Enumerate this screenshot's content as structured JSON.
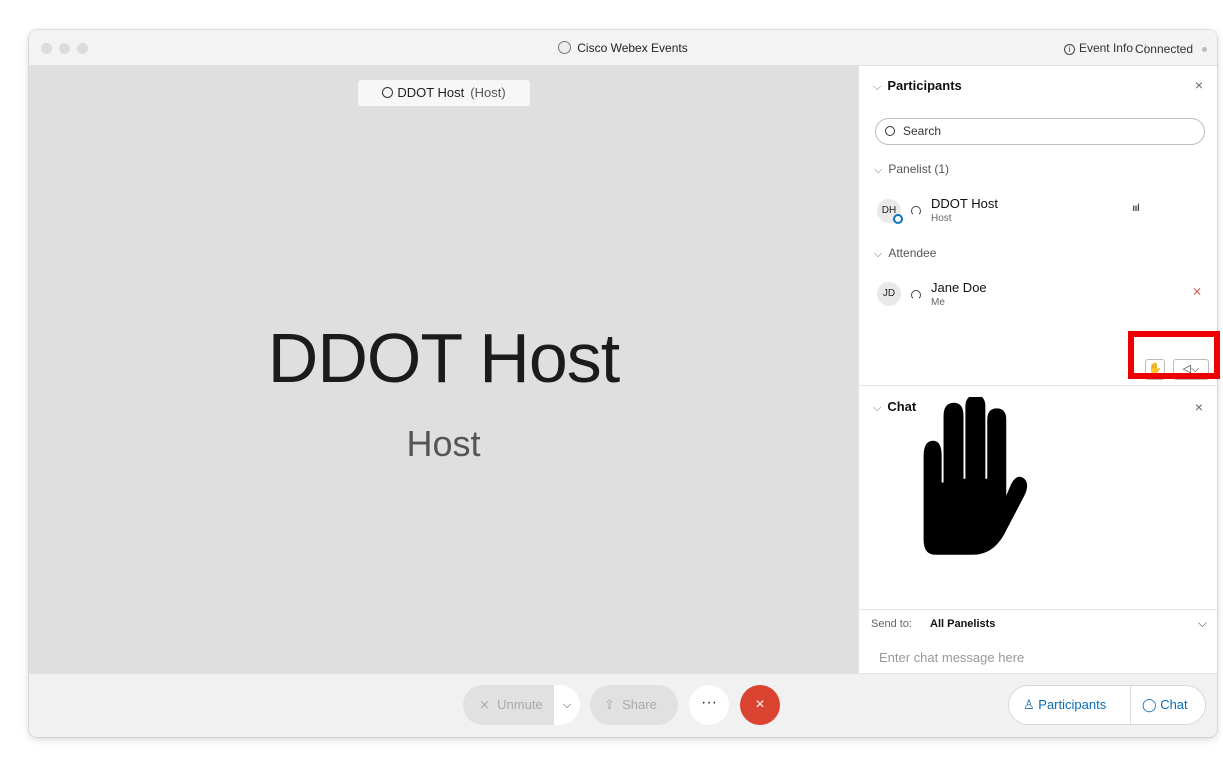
{
  "window": {
    "title": "Cisco Webex Events",
    "event_info": "Event Info",
    "separator": "|",
    "status": "Connected"
  },
  "stage": {
    "name_chip": "DDOT Host",
    "name_chip_role": "(Host)",
    "presenter_name": "DDOT Host",
    "presenter_role": "Host"
  },
  "participants": {
    "header": "Participants",
    "close": "×",
    "search_placeholder": "Search",
    "groups": [
      {
        "label": "Panelist (1)"
      },
      {
        "label": "Attendee"
      }
    ],
    "people": [
      {
        "initials": "DH",
        "name": "DDOT Host",
        "role": "Host"
      },
      {
        "initials": "JD",
        "name": "Jane Doe",
        "role": "Me"
      }
    ]
  },
  "chat": {
    "header": "Chat",
    "close": "×",
    "send_to_label": "Send to:",
    "send_to_value": "All Panelists",
    "input_placeholder": "Enter chat message here"
  },
  "controls": {
    "unmute": "Unmute",
    "share": "Share",
    "more": "···",
    "end": "×",
    "participants": "Participants",
    "chat": "Chat"
  },
  "colors": {
    "accent": "#0a6cb5",
    "end_call": "#d9432f",
    "highlight": "#ee0000"
  }
}
